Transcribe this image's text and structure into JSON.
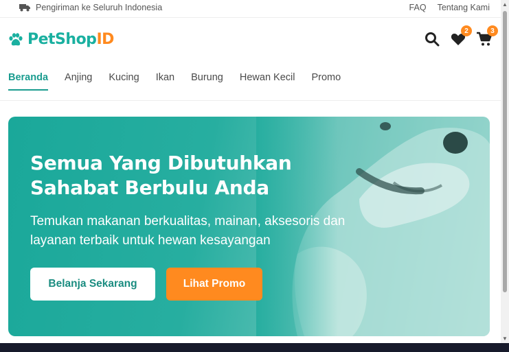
{
  "topbar": {
    "shipping_text": "Pengiriman ke Seluruh Indonesia",
    "shipping_icon": "truck-icon",
    "links": [
      "FAQ",
      "Tentang Kami"
    ]
  },
  "header": {
    "logo_part1": "PetShop",
    "logo_part2": "ID",
    "logo_icon": "paw-icon",
    "wishlist_count": "2",
    "cart_count": "3"
  },
  "nav": {
    "items": [
      "Beranda",
      "Anjing",
      "Kucing",
      "Ikan",
      "Burung",
      "Hewan Kecil",
      "Promo"
    ],
    "active": "Beranda"
  },
  "hero": {
    "title_line1": "Semua Yang Dibutuhkan",
    "title_line2": "Sahabat Berbulu Anda",
    "subtitle_line1": "Temukan makanan berkualitas, mainan, aksesoris dan",
    "subtitle_line2": "layanan terbaik untuk hewan kesayangan",
    "primary_button": "Belanja Sekarang",
    "secondary_button": "Lihat Promo"
  },
  "colors": {
    "brand_teal": "#1ab0a0",
    "brand_orange": "#ff8a1f",
    "nav_active": "#1a9c8f"
  }
}
